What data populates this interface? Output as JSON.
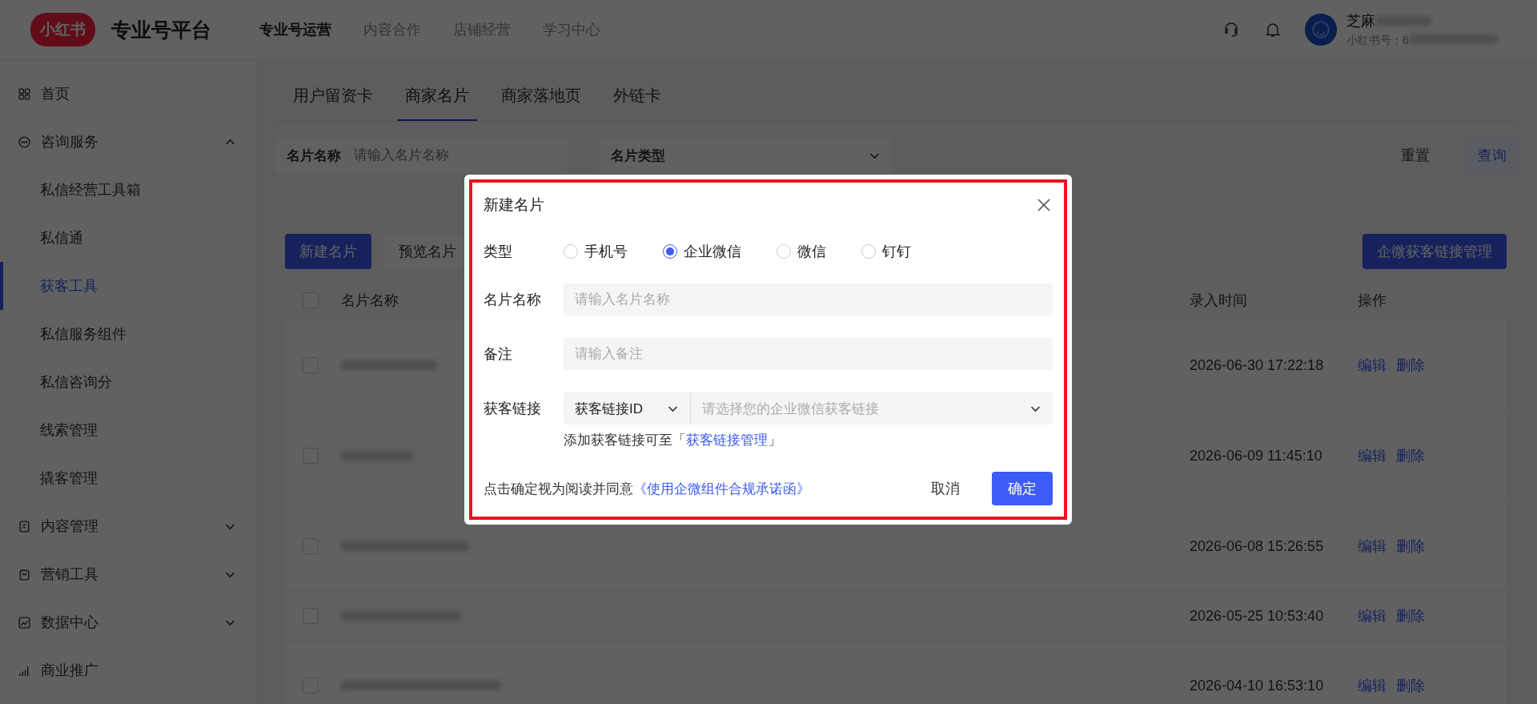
{
  "header": {
    "logo": "小红书",
    "title": "专业号平台",
    "nav": [
      {
        "label": "专业号运营",
        "selected": true
      },
      {
        "label": "内容合作",
        "selected": false
      },
      {
        "label": "店铺经营",
        "selected": false
      },
      {
        "label": "学习中心",
        "selected": false
      }
    ],
    "user": {
      "name": "芝麻",
      "account": "小红书号：6"
    }
  },
  "sidebar": {
    "items": [
      {
        "label": "首页",
        "kind": "link"
      },
      {
        "label": "咨询服务",
        "kind": "group",
        "expanded": true,
        "children": [
          {
            "label": "私信经营工具箱",
            "selected": false
          },
          {
            "label": "私信通",
            "selected": false
          },
          {
            "label": "获客工具",
            "selected": true
          },
          {
            "label": "私信服务组件",
            "selected": false
          },
          {
            "label": "私信咨询分",
            "selected": false
          },
          {
            "label": "线索管理",
            "selected": false
          },
          {
            "label": "撬客管理",
            "selected": false
          }
        ]
      },
      {
        "label": "内容管理",
        "kind": "group",
        "expanded": false
      },
      {
        "label": "营销工具",
        "kind": "group",
        "expanded": false
      },
      {
        "label": "数据中心",
        "kind": "group",
        "expanded": false
      },
      {
        "label": "商业推广",
        "kind": "link"
      }
    ]
  },
  "tabs": [
    {
      "label": "用户留资卡",
      "selected": false
    },
    {
      "label": "商家名片",
      "selected": true
    },
    {
      "label": "商家落地页",
      "selected": false
    },
    {
      "label": "外链卡",
      "selected": false
    }
  ],
  "filters": [
    {
      "kind": "input",
      "label": "名片名称",
      "placeholder": "请输入名片名称"
    },
    {
      "kind": "select",
      "label": "名片类型"
    }
  ],
  "filter_actions": {
    "reset": "重置",
    "query": "查询"
  },
  "toolbar": {
    "buttons": [
      "新建名片",
      "预览名片"
    ],
    "right_button": "企微获客链接管理"
  },
  "table": {
    "all_checked": false,
    "columns": [
      "名片名称",
      "录入时间",
      "操作"
    ],
    "rows": [
      {
        "checked": false,
        "time": "2026-06-30 17:22:18",
        "actions": [
          "编辑",
          "删除"
        ]
      },
      {
        "checked": false,
        "time": "2026-06-09 11:45:10",
        "actions": [
          "编辑",
          "删除"
        ]
      },
      {
        "checked": false,
        "time": "2026-06-08 15:26:55",
        "actions": [
          "编辑",
          "删除"
        ]
      },
      {
        "checked": false,
        "time": "2026-05-25 10:53:40",
        "actions": [
          "编辑",
          "删除"
        ]
      },
      {
        "checked": false,
        "time": "2026-04-10 16:53:10",
        "actions": [
          "编辑",
          "删除"
        ]
      }
    ]
  },
  "dialog": {
    "title": "新建名片",
    "type": {
      "label": "类型",
      "options": [
        {
          "label": "手机号",
          "selected": false
        },
        {
          "label": "企业微信",
          "selected": true
        },
        {
          "label": "微信",
          "selected": false
        },
        {
          "label": "钉钉",
          "selected": false
        }
      ]
    },
    "name": {
      "label": "名片名称",
      "placeholder": "请输入名片名称"
    },
    "remark": {
      "label": "备注",
      "placeholder": "请输入备注"
    },
    "link": {
      "label": "获客链接",
      "select": "获客链接ID",
      "placeholder": "请选择您的企业微信获客链接",
      "hint": "添加获客链接可至「",
      "hint_link": "获客链接管理",
      "hint_end": "」"
    },
    "agreement": {
      "text": "点击确定视为阅读并同意",
      "link": "《使用企微组件合规承诺函》"
    },
    "cancel": "取消",
    "ok": "确定"
  }
}
